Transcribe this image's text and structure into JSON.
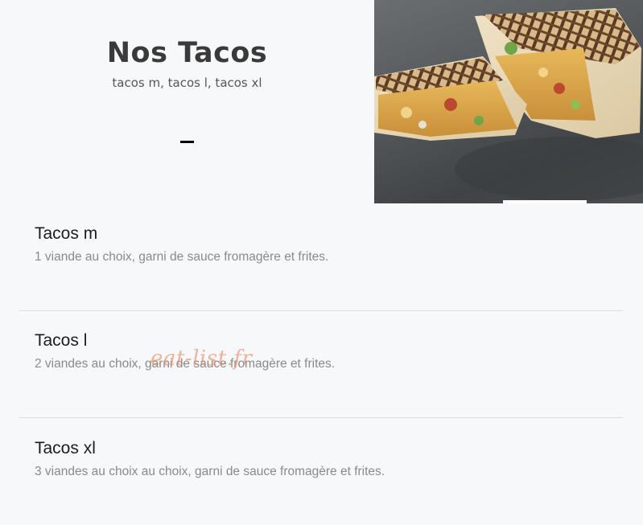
{
  "header": {
    "title": "Nos Tacos",
    "subtitle": "tacos m, tacos l, tacos xl"
  },
  "hero_image": {
    "icon": "tacos-photo"
  },
  "menu": {
    "items": [
      {
        "name": "Tacos m",
        "description": "1 viande au choix, garni de sauce fromagère et frites."
      },
      {
        "name": "Tacos l",
        "description": "2 viandes au choix, garni de sauce fromagère et frites."
      },
      {
        "name": "Tacos xl",
        "description": "3 viandes au choix au choix, garni de sauce fromagère et frites."
      }
    ]
  },
  "watermark": {
    "text": "eat-list.fr"
  },
  "colors": {
    "background": "#f7f8f9",
    "title": "#3a3a3a",
    "item_name": "#1d1d1d",
    "item_desc": "#8a8a8a",
    "divider": "#dcdcdc",
    "watermark": "#ec8c64"
  }
}
